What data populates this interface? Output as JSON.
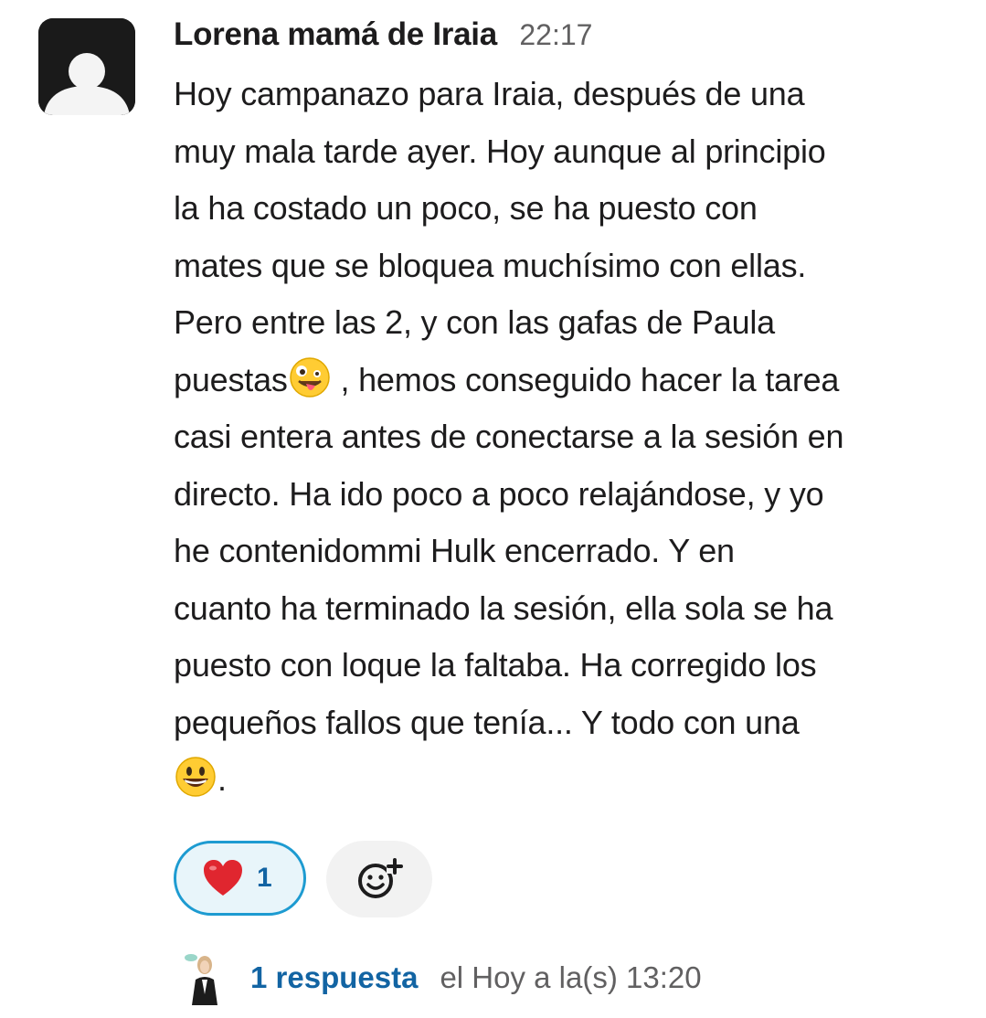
{
  "message": {
    "author": "Lorena mamá de Iraia",
    "time": "22:17",
    "lines": [
      {
        "text": "Hoy campanazo para Iraia, después de una"
      },
      {
        "text": "muy mala tarde ayer. Hoy aunque al principio"
      },
      {
        "text": "la ha costado un poco, se ha puesto con"
      },
      {
        "text": "mates que se bloquea muchísimo con ellas."
      },
      {
        "text": "Pero entre las 2, y con las gafas de Paula"
      },
      {
        "before": "puestas",
        "emoji": "zany-face-emoji",
        "after": " , hemos conseguido hacer la tarea"
      },
      {
        "text": "casi entera antes de conectarse a la sesión en"
      },
      {
        "text": "directo. Ha ido poco a poco relajándose, y yo"
      },
      {
        "text": "he contenidommi Hulk encerrado. Y en"
      },
      {
        "text": "cuanto ha terminado la sesión, ella sola se ha"
      },
      {
        "text": "puesto con loque la faltaba. Ha corregido los"
      },
      {
        "text": "pequeños fallos que tenía... Y todo con una"
      },
      {
        "before": "",
        "emoji": "grinning-face-emoji",
        "after": "."
      }
    ]
  },
  "reactions": [
    {
      "emoji": "red-heart-emoji",
      "count": "1",
      "selected": true
    }
  ],
  "add_reaction_icon": "add-reaction-icon",
  "thread": {
    "reply_count": "1 respuesta",
    "last_reply": "el Hoy a la(s) 13:20"
  },
  "colors": {
    "link": "#1264a3",
    "reaction_border": "#1d9bd1",
    "reaction_bg": "#e8f5fa",
    "muted": "#616061"
  }
}
